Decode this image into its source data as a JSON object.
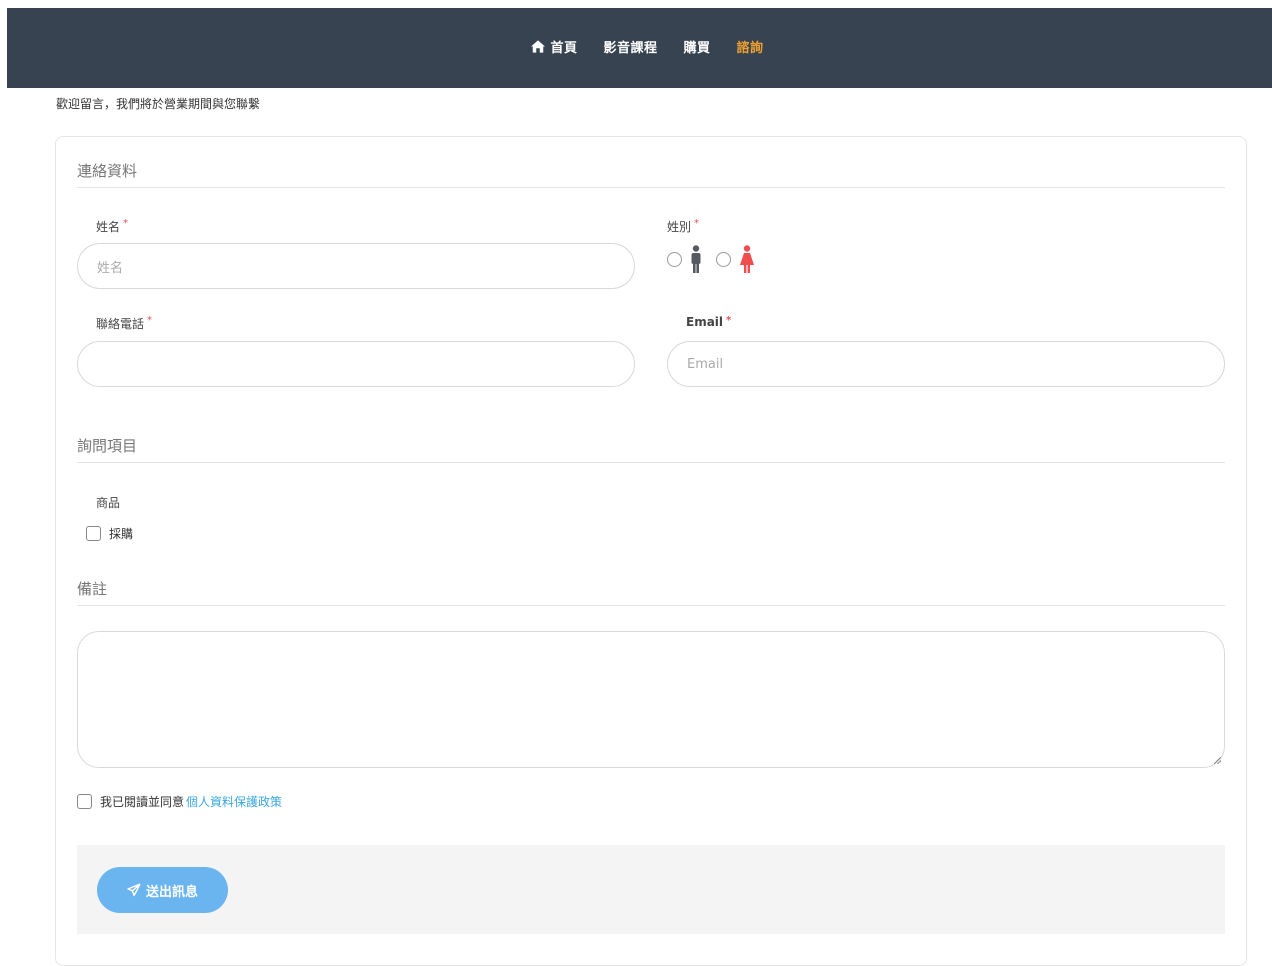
{
  "nav": {
    "items": [
      {
        "label": "首頁",
        "icon": "home-icon",
        "active": false
      },
      {
        "label": "影音課程",
        "active": false
      },
      {
        "label": "購買",
        "active": false
      },
      {
        "label": "諮詢",
        "active": true
      }
    ],
    "active_color": "#f0a030",
    "background": "#374351"
  },
  "intro_text": "歡迎留言，我們將於營業期間與您聯繫",
  "contact_section": {
    "title": "連絡資料",
    "name": {
      "label": "姓名",
      "required_mark": "*",
      "placeholder": "姓名",
      "value": ""
    },
    "gender": {
      "label": "姓別",
      "required_mark": "*",
      "options": [
        "male-icon",
        "female-icon"
      ],
      "selected": null
    },
    "phone": {
      "label": "聯絡電話",
      "required_mark": "*",
      "value": ""
    },
    "email": {
      "label": "Email",
      "required_mark": "*",
      "placeholder": "Email",
      "value": ""
    }
  },
  "inquiry_section": {
    "title": "詢問項目",
    "group_label": "商品",
    "options": [
      {
        "label": "採購",
        "checked": false
      }
    ]
  },
  "notes_section": {
    "title": "備註",
    "value": ""
  },
  "agreement": {
    "text": "我已閱讀並同意",
    "link_text": "個人資料保護政策",
    "checked": false
  },
  "submit": {
    "label": "送出訊息",
    "icon": "paper-plane-icon",
    "color": "#6ab4f0"
  }
}
